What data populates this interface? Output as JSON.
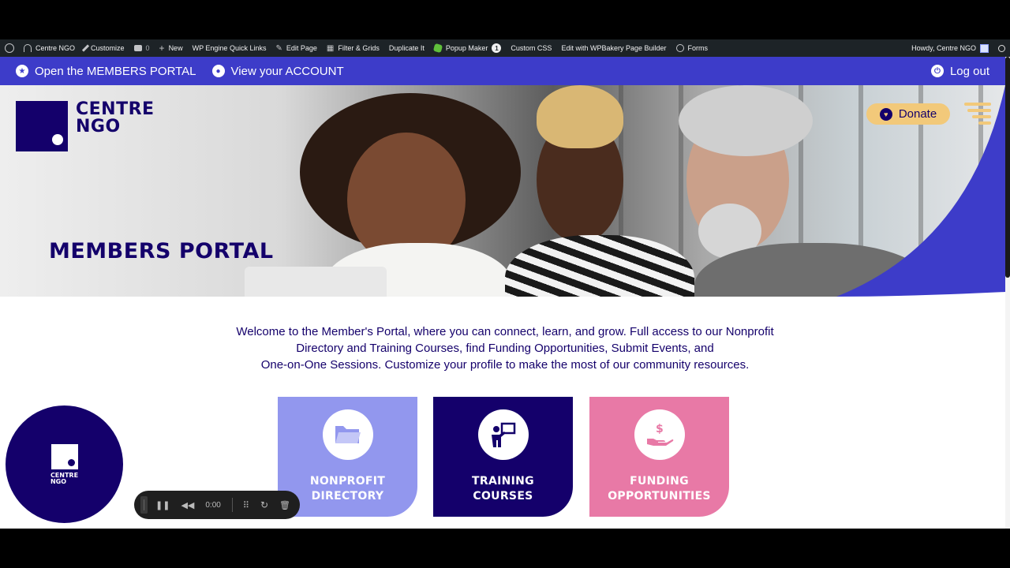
{
  "wp_admin_bar": {
    "items": [
      {
        "label": "Centre NGO",
        "icon": "dashboard-icon"
      },
      {
        "label": "Customize",
        "icon": "brush-icon"
      },
      {
        "label": "0",
        "icon": "comment-icon"
      },
      {
        "label": "New",
        "icon": "plus-icon"
      },
      {
        "label": "WP Engine Quick Links",
        "icon": ""
      },
      {
        "label": "Edit Page",
        "icon": "pencil-icon"
      },
      {
        "label": "Filter & Grids",
        "icon": "grid-icon"
      },
      {
        "label": "Duplicate It",
        "icon": ""
      },
      {
        "label": "Popup Maker",
        "icon": "popup-maker-icon",
        "badge": "1"
      },
      {
        "label": "Custom CSS",
        "icon": ""
      },
      {
        "label": "Edit with WPBakery Page Builder",
        "icon": ""
      },
      {
        "label": "Forms",
        "icon": "forms-icon"
      }
    ],
    "greeting": "Howdy, Centre NGO"
  },
  "member_nav": {
    "portal_link": "Open the MEMBERS PORTAL",
    "account_link": "View your ACCOUNT",
    "logout": "Log out"
  },
  "brand": {
    "line1": "CENTRE",
    "line2": "NGO",
    "primary_color": "#14006b",
    "accent_color": "#3d3cc9",
    "gold_color": "#f2c97a"
  },
  "hero": {
    "title": "MEMBERS PORTAL",
    "donate": "Donate"
  },
  "intro": {
    "line1": "Welcome to the Member's Portal, where you can connect, learn, and grow. Full access to our Nonprofit",
    "line2": "Directory and Training Courses, find Funding Opportunities, Submit Events, and",
    "line3": "One-on-One Sessions. Customize your profile to make the most of our community resources."
  },
  "cards": [
    {
      "line1": "NONPROFIT",
      "line2": "DIRECTORY",
      "icon": "folder-icon",
      "color": "#9297ee"
    },
    {
      "line1": "TRAINING",
      "line2": "COURSES",
      "icon": "presenter-icon",
      "color": "#14006b"
    },
    {
      "line1": "FUNDING",
      "line2": "OPPORTUNITIES",
      "icon": "money-hand-icon",
      "color": "#e879a6"
    }
  ],
  "bubble": {
    "line1": "CENTRE",
    "line2": "NGO"
  },
  "recorder": {
    "time": "0:00"
  }
}
